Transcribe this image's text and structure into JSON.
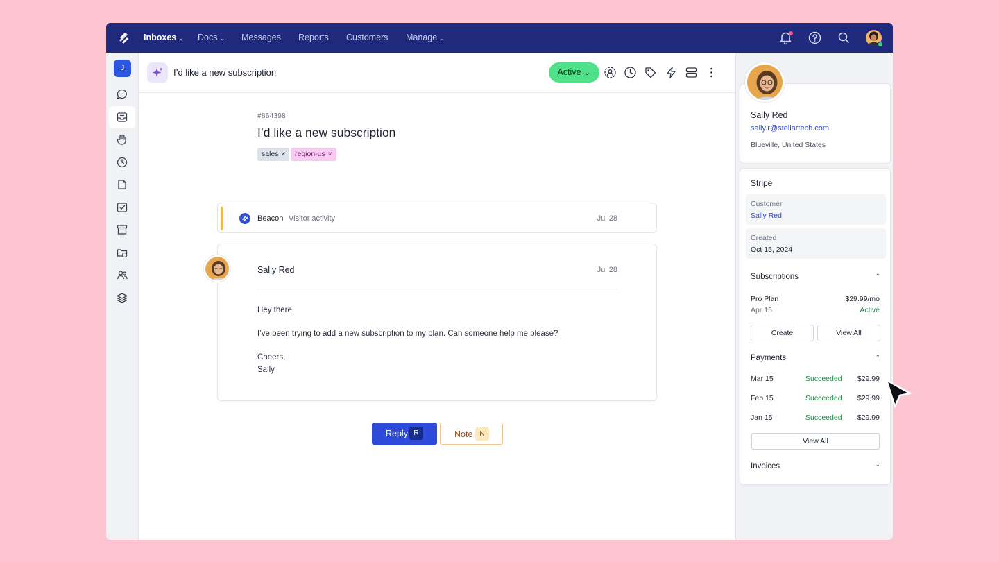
{
  "nav": {
    "items": [
      {
        "label": "Inboxes",
        "chevron": true
      },
      {
        "label": "Docs",
        "chevron": true
      },
      {
        "label": "Messages",
        "chevron": false
      },
      {
        "label": "Reports",
        "chevron": false
      },
      {
        "label": "Customers",
        "chevron": false
      },
      {
        "label": "Manage",
        "chevron": true
      }
    ],
    "chevron_glyph": "⌄",
    "icons": [
      "bell-icon",
      "help-icon",
      "search-icon",
      "avatar"
    ]
  },
  "rail": {
    "user_initial": "J",
    "icons": [
      "chat-bubble-icon",
      "inbox-icon",
      "hand-icon",
      "clock-icon",
      "document-icon",
      "mail-check-icon",
      "archive-icon",
      "folder-shield-icon",
      "users-icon",
      "layers-icon"
    ]
  },
  "header": {
    "title": "I’d like a new subscription",
    "status": "Active ⌄"
  },
  "conversation": {
    "ticket_number": "#864398",
    "title": "I’d like a new subscription",
    "tags": [
      {
        "label": "sales",
        "bg": "#dde2ea",
        "fg": "#2c3140"
      },
      {
        "label": "region-us",
        "bg": "#f7ccf2",
        "fg": "#7a1d6e"
      }
    ],
    "tag_remove": "×",
    "activity": {
      "name": "Beacon",
      "type": "Visitor activity",
      "date": "Jul 28"
    },
    "message": {
      "author": "Sally Red",
      "date": "Jul 28",
      "lines": [
        "Hey there,",
        "I’ve been trying to add a new subscription to my plan. Can someone help me please?",
        "Cheers,",
        "Sally"
      ]
    }
  },
  "composer": {
    "reply_label": "Reply",
    "reply_key": "R",
    "note_label": "Note",
    "note_key": "N"
  },
  "customer": {
    "name": "Sally Red",
    "email": "sally.r@stellartech.com",
    "location": "Blueville, United States"
  },
  "stripe": {
    "title": "Stripe",
    "customer_label": "Customer",
    "customer_value": "Sally Red",
    "created_label": "Created",
    "created_value": "Oct 15, 2024",
    "subscriptions_label": "Subscriptions",
    "subscription": {
      "plan": "Pro Plan",
      "price": "$29.99/mo",
      "date": "Apr 15",
      "status": "Active"
    },
    "create_label": "Create",
    "view_all_label": "View All",
    "payments_label": "Payments",
    "payments": [
      {
        "date": "Mar 15",
        "status": "Succeeded",
        "amount": "$29.99"
      },
      {
        "date": "Feb 15",
        "status": "Succeeded",
        "amount": "$29.99"
      },
      {
        "date": "Jan 15",
        "status": "Succeeded",
        "amount": "$29.99"
      }
    ],
    "payments_view_all_label": "View All",
    "invoices_label": "Invoices",
    "caret_up": "⌃",
    "caret_down": "⌄"
  },
  "colors": {
    "nav_bg": "#1f2a7c",
    "accent": "#2d4ad8",
    "status_green": "#4fe08a",
    "page_bg": "#fcc5d1"
  }
}
